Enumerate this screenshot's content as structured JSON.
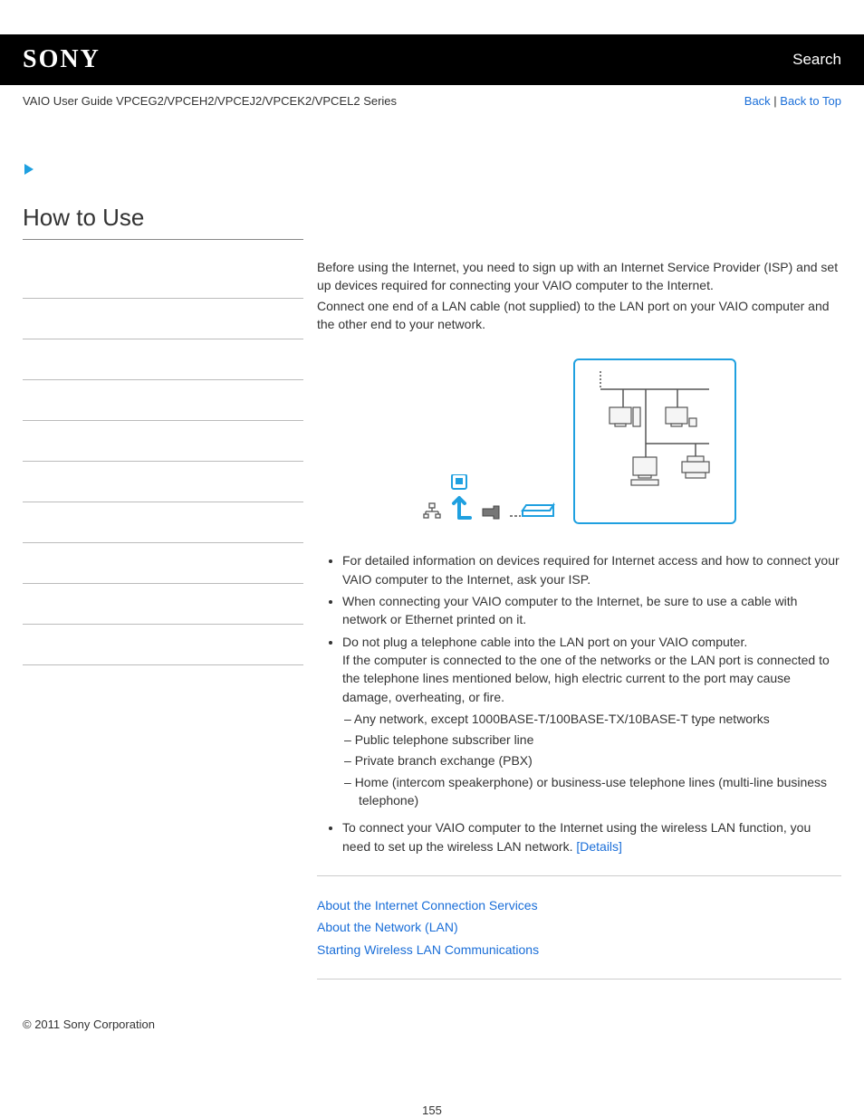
{
  "header": {
    "logo": "SONY",
    "search": "Search"
  },
  "subheader": {
    "guide_title": "VAIO User Guide VPCEG2/VPCEH2/VPCEJ2/VPCEK2/VPCEL2 Series",
    "back": "Back",
    "back_to_top": "Back to Top",
    "sep": " | "
  },
  "page": {
    "title": "How to Use"
  },
  "intro": {
    "p1": "Before using the Internet, you need to sign up with an Internet Service Provider (ISP) and set up devices required for connecting your VAIO computer to the Internet.",
    "p2": "Connect one end of a LAN cable (not supplied) to the LAN port on your VAIO computer and the other end to your network."
  },
  "bullets": {
    "b1": "For detailed information on devices required for Internet access and how to connect your VAIO computer to the Internet, ask your ISP.",
    "b2": "When connecting your VAIO computer to the Internet, be sure to use a cable with network or Ethernet printed on it.",
    "b3a": "Do not plug a telephone cable into the LAN port on your VAIO computer.",
    "b3b": "If the computer is connected to the one of the networks or the LAN port is connected to the telephone lines mentioned below, high electric current to the port may cause damage, overheating, or fire.",
    "d1": "Any network, except 1000BASE-T/100BASE-TX/10BASE-T type networks",
    "d2": "Public telephone subscriber line",
    "d3": "Private branch exchange (PBX)",
    "d4": "Home (intercom speakerphone) or business-use telephone lines (multi-line business telephone)",
    "b4": "To connect your VAIO computer to the Internet using the wireless LAN function, you need to set up the wireless LAN network. ",
    "details": "[Details]"
  },
  "related": {
    "r1": "About the Internet Connection Services",
    "r2": "About the Network (LAN)",
    "r3": "Starting Wireless LAN Communications"
  },
  "footer": {
    "copyright": "© 2011 Sony Corporation",
    "page_num": "155"
  }
}
